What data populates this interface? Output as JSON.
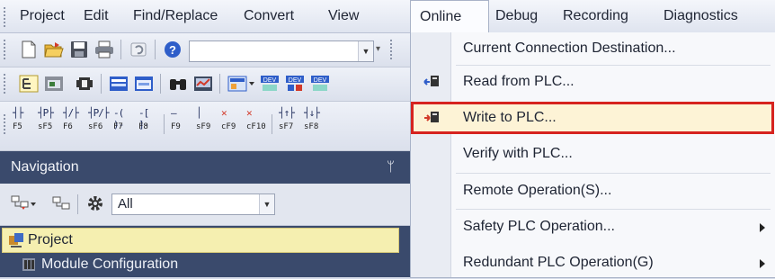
{
  "menubar": {
    "items": [
      "Project",
      "Edit",
      "Find/Replace",
      "Convert",
      "View",
      "Online",
      "Debug",
      "Recording",
      "Diagnostics"
    ]
  },
  "toolbar2": {
    "combo_value": ""
  },
  "fkeys": [
    {
      "label": "F5",
      "sym": "┤├"
    },
    {
      "label": "sF5",
      "sym": "┤P├"
    },
    {
      "label": "F6",
      "sym": "┤/├"
    },
    {
      "label": "sF6",
      "sym": "┤P/├"
    },
    {
      "label": "F7",
      "sym": "-( )-"
    },
    {
      "label": "F8",
      "sym": "-[ ]-"
    },
    {
      "label": "F9",
      "sym": "—"
    },
    {
      "label": "sF9",
      "sym": "│"
    },
    {
      "label": "cF9",
      "sym": "✕"
    },
    {
      "label": "cF10",
      "sym": "✕"
    },
    {
      "label": "sF7",
      "sym": "┤↑├"
    },
    {
      "label": "sF8",
      "sym": "┤↓├"
    }
  ],
  "navigation": {
    "title": "Navigation",
    "pin": "ᛘ",
    "filter_value": "All",
    "tree": [
      {
        "label": "Project"
      },
      {
        "label": "Module Configuration"
      }
    ]
  },
  "online_menu": {
    "items": [
      {
        "label": "Current Connection Destination...",
        "icon": "none",
        "submenu": false
      },
      {
        "label": "Read from PLC...",
        "icon": "read-plc-icon",
        "submenu": false
      },
      {
        "label": "Write to PLC...",
        "icon": "write-plc-icon",
        "submenu": false
      },
      {
        "label": "Verify with PLC...",
        "icon": "none",
        "submenu": false
      },
      {
        "label": "Remote Operation(S)...",
        "icon": "none",
        "submenu": false
      },
      {
        "label": "Safety PLC Operation...",
        "icon": "none",
        "submenu": true
      },
      {
        "label": "Redundant PLC Operation(G)",
        "icon": "none",
        "submenu": true
      }
    ],
    "highlighted": "Write to PLC...",
    "highlight_color": "#d6231f"
  }
}
